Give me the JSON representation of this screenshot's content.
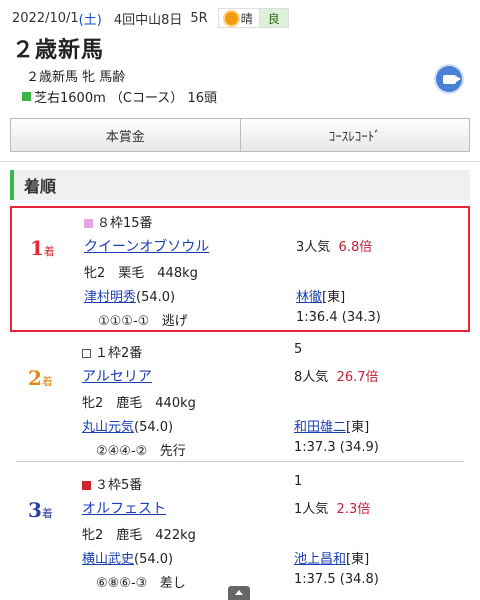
{
  "race": {
    "date": "2022/10/1",
    "weekday": "(土)",
    "meeting": "4回中山8日",
    "race_no": "5R",
    "weather": "晴",
    "track_condition": "良",
    "name": "２歳新馬",
    "conditions": "２歳新馬 牝 馬齢",
    "course": "芝右1600m （Cコース） 16頭"
  },
  "buttons": {
    "prize": "本賞金",
    "course_record": "ｺｰｽﾚｺｰﾄﾞ"
  },
  "section_title": "着順",
  "results": [
    {
      "rank": "1",
      "rank_suffix": "着",
      "frame_number": "８枠15番",
      "frame_color": "#e6a3e6",
      "horse": "クイーンオブソウル",
      "popularity": "3人気",
      "odds": "6.8倍",
      "profile": "牝2　栗毛　448kg",
      "jockey": "津村明秀",
      "weight": "(54.0)",
      "trainer": "林徹",
      "stable": "[東]",
      "passing": "①①①-①",
      "style": "逃げ",
      "time": "1:36.4",
      "last3f": "(34.3)"
    },
    {
      "rank": "2",
      "rank_suffix": "着",
      "frame_number": "１枠2番",
      "frame_color": "#ffffff",
      "extra": "5",
      "horse": "アルセリア",
      "popularity": "8人気",
      "odds": "26.7倍",
      "profile": "牝2　鹿毛　440kg",
      "jockey": "丸山元気",
      "weight": "(54.0)",
      "trainer": "和田雄二",
      "stable": "[東]",
      "passing": "②④④-②",
      "style": "先行",
      "time": "1:37.3",
      "last3f": "(34.9)"
    },
    {
      "rank": "3",
      "rank_suffix": "着",
      "frame_number": "３枠5番",
      "frame_color": "#d0262e",
      "extra": "1",
      "horse": "オルフェスト",
      "popularity": "1人気",
      "odds": "2.3倍",
      "profile": "牝2　鹿毛　422kg",
      "jockey": "横山武史",
      "weight": "(54.0)",
      "trainer": "池上昌和",
      "stable": "[東]",
      "passing": "⑥⑧⑥-③",
      "style": "差し",
      "time": "1:37.5",
      "last3f": "(34.8)"
    }
  ]
}
